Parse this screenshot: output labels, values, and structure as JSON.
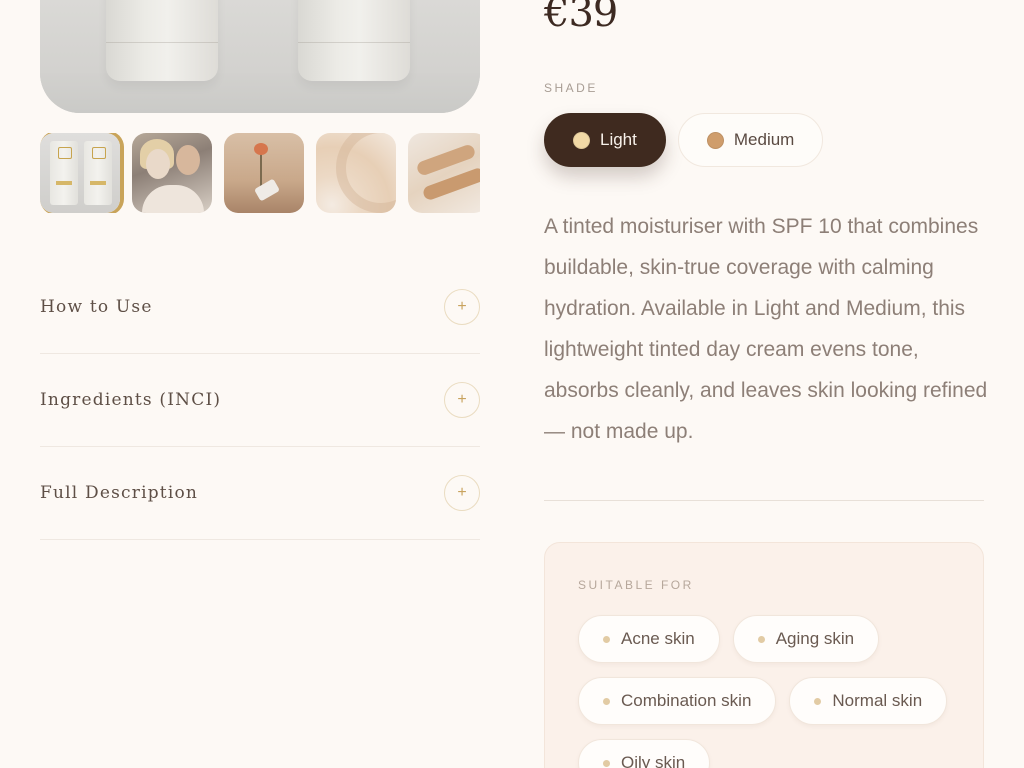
{
  "product": {
    "price": "€39"
  },
  "gallery": {
    "thumbnails": [
      {
        "alt": "product-tubes",
        "active": true
      },
      {
        "alt": "models",
        "active": false
      },
      {
        "alt": "flower-still-life",
        "active": false
      },
      {
        "alt": "cream-swirl",
        "active": false
      },
      {
        "alt": "cream-swatch",
        "active": false
      }
    ]
  },
  "accordion": {
    "items": [
      {
        "title": "How to Use",
        "icon": "plus-icon",
        "toggle": "+"
      },
      {
        "title": "Ingredients (INCI)",
        "icon": "plus-icon",
        "toggle": "+"
      },
      {
        "title": "Full Description",
        "icon": "plus-icon",
        "toggle": "+"
      }
    ]
  },
  "shade": {
    "label": "SHADE",
    "options": [
      {
        "label": "Light",
        "color": "#f2d9a6",
        "selected": true
      },
      {
        "label": "Medium",
        "color": "#cf9d6c",
        "selected": false
      }
    ]
  },
  "description": "A tinted moisturiser with SPF 10 that combines buildable, skin-true coverage with calming hydration. Available in Light and Medium, this lightweight tinted day cream evens tone, absorbs cleanly, and leaves skin looking refined — not made up.",
  "suitable_for": {
    "label": "SUITABLE FOR",
    "items": [
      "Acne skin",
      "Aging skin",
      "Combination skin",
      "Normal skin",
      "Oily skin"
    ]
  },
  "colors": {
    "background": "#fdf9f5",
    "accent_gold": "#c9a45a",
    "selected_shade_bg": "#3f2a1f"
  }
}
